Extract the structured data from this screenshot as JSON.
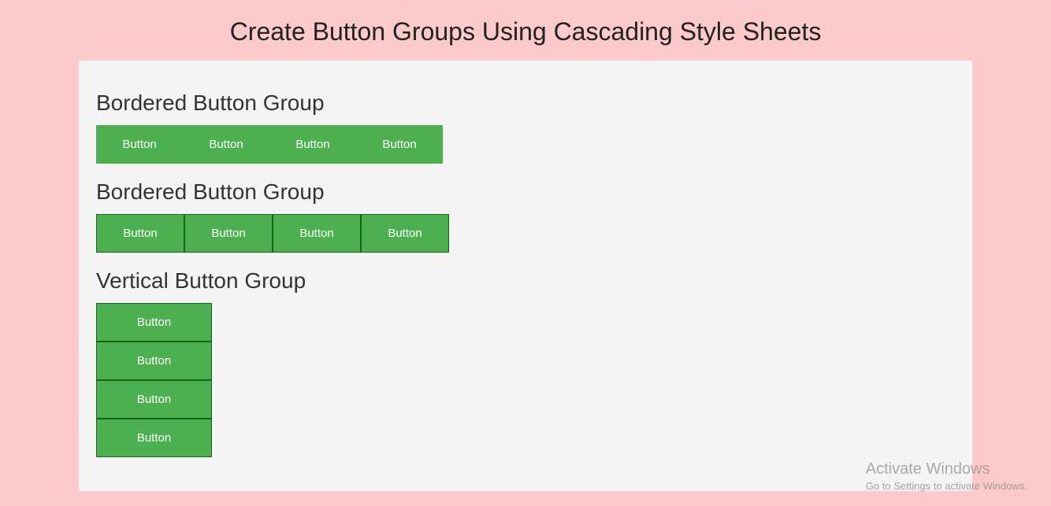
{
  "page_title": "Create Button Groups Using Cascading Style Sheets",
  "sections": [
    {
      "heading": "Bordered Button Group",
      "buttons": [
        "Button",
        "Button",
        "Button",
        "Button"
      ]
    },
    {
      "heading": "Bordered Button Group",
      "buttons": [
        "Button",
        "Button",
        "Button",
        "Button"
      ]
    },
    {
      "heading": "Vertical Button Group",
      "buttons": [
        "Button",
        "Button",
        "Button",
        "Button"
      ]
    }
  ],
  "watermark": {
    "title": "Activate Windows",
    "subtitle": "Go to Settings to activate Windows."
  }
}
